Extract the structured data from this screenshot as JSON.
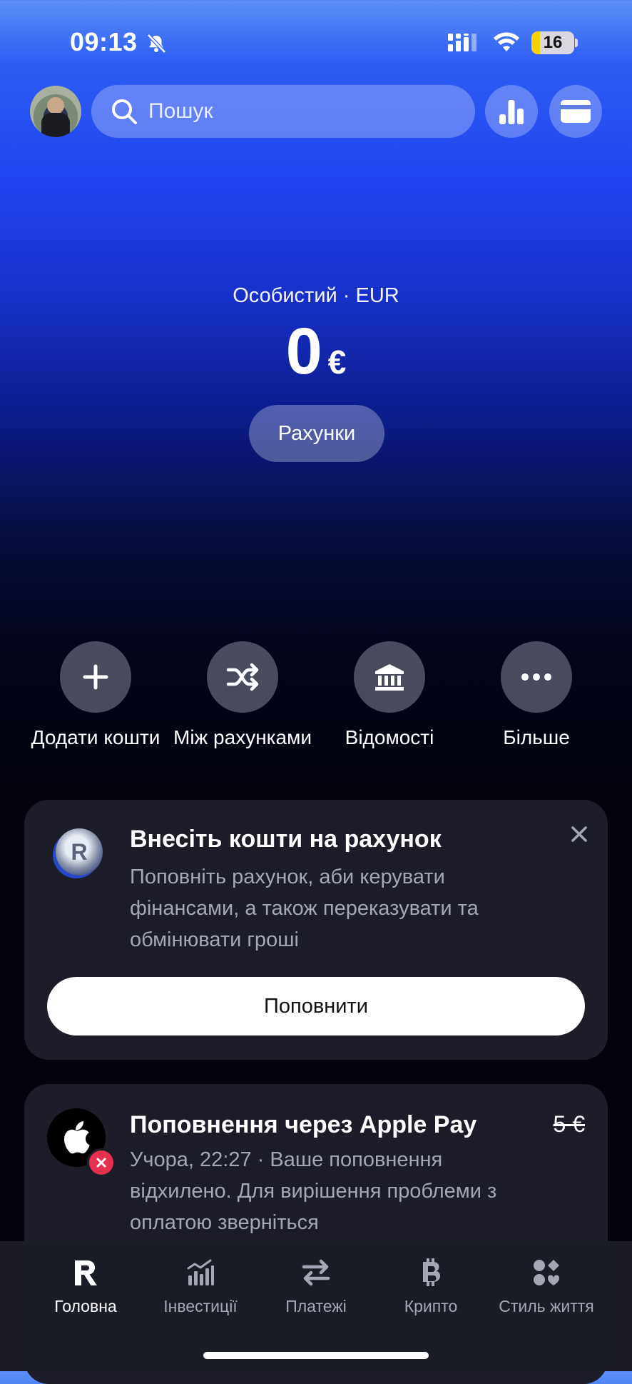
{
  "status_bar": {
    "time": "09:13",
    "battery": "16",
    "battery_color": "#f6d200",
    "icons": [
      "bell-slash-icon",
      "signal-icon",
      "wifi-icon",
      "battery-icon"
    ]
  },
  "header": {
    "search_placeholder": "Пошук",
    "icons": [
      "search-icon",
      "stats-icon",
      "card-icon"
    ]
  },
  "balance": {
    "account_label": "Особистий · EUR",
    "amount": "0",
    "currency": "€",
    "accounts_button": "Рахунки"
  },
  "actions": [
    {
      "label": "Додати кошти",
      "icon": "plus-icon"
    },
    {
      "label": "Між рахунками",
      "icon": "shuffle-icon"
    },
    {
      "label": "Відомості",
      "icon": "bank-icon"
    },
    {
      "label": "Більше",
      "icon": "more-icon"
    }
  ],
  "promo": {
    "title": "Внесіть кошти на рахунок",
    "text": "Поповніть рахунок, аби керувати фінансами, а також переказувати та обмінювати гроші",
    "button": "Поповнити",
    "coin_letter": "R"
  },
  "transaction": {
    "title": "Поповнення через Apple Pay",
    "amount": "5 €",
    "text": "Учора, 22:27 · Ваше поповнення відхилено. Для вирішення проблеми з оплатою зверніться",
    "status_color": "#e5304e"
  },
  "tabbar": {
    "tabs": [
      {
        "label": "Головна",
        "icon": "revolut-logo-icon",
        "active": true
      },
      {
        "label": "Інвестиції",
        "icon": "invest-chart-icon",
        "active": false
      },
      {
        "label": "Платежі",
        "icon": "transfer-arrows-icon",
        "active": false
      },
      {
        "label": "Крипто",
        "icon": "bitcoin-icon",
        "active": false
      },
      {
        "label": "Стиль життя",
        "icon": "lifestyle-icon",
        "active": false
      }
    ]
  },
  "colors": {
    "accent_blue": "#1f44ef",
    "card_bg": "#1c1d29",
    "muted_text": "#a4a7b6"
  }
}
